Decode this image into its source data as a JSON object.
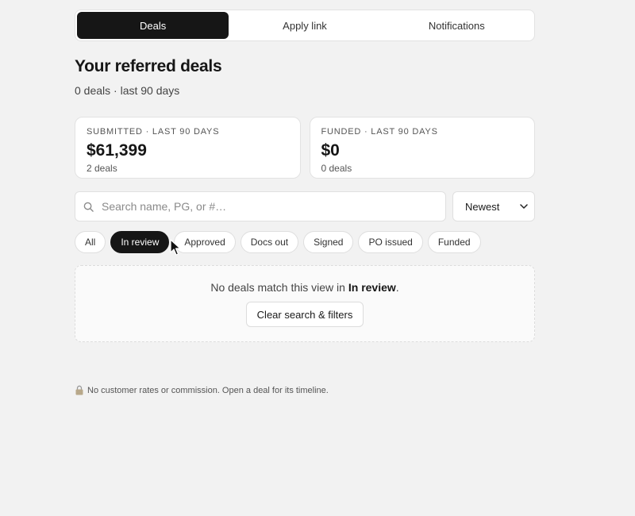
{
  "tabs": [
    {
      "label": "Deals",
      "active": true
    },
    {
      "label": "Apply link",
      "active": false
    },
    {
      "label": "Notifications",
      "active": false
    }
  ],
  "header": {
    "title": "Your referred deals",
    "subtitle": "0 deals · last 90 days"
  },
  "summary": {
    "submitted": {
      "label": "SUBMITTED · LAST 90 DAYS",
      "value": "$61,399",
      "count": "2 deals"
    },
    "funded": {
      "label": "FUNDED · LAST 90 DAYS",
      "value": "$0",
      "count": "0 deals"
    }
  },
  "search": {
    "placeholder": "Search name, PG, or #…",
    "value": "",
    "icon": "search-icon"
  },
  "sort": {
    "selected": "Newest",
    "icon": "chevron-down-icon"
  },
  "filters": [
    {
      "label": "All",
      "active": false
    },
    {
      "label": "In review",
      "active": true
    },
    {
      "label": "Approved",
      "active": false
    },
    {
      "label": "Docs out",
      "active": false
    },
    {
      "label": "Signed",
      "active": false
    },
    {
      "label": "PO issued",
      "active": false
    },
    {
      "label": "Funded",
      "active": false
    }
  ],
  "empty_state": {
    "message_prefix": "No deals match this view in ",
    "message_filter": "In review",
    "message_suffix": ".",
    "clear_label": "Clear search & filters"
  },
  "footer": {
    "icon": "lock-icon",
    "text": "No customer rates or commission. Open a deal for its timeline."
  },
  "colors": {
    "background": "#f2f2f2",
    "active": "#161616",
    "surface": "#ffffff"
  }
}
